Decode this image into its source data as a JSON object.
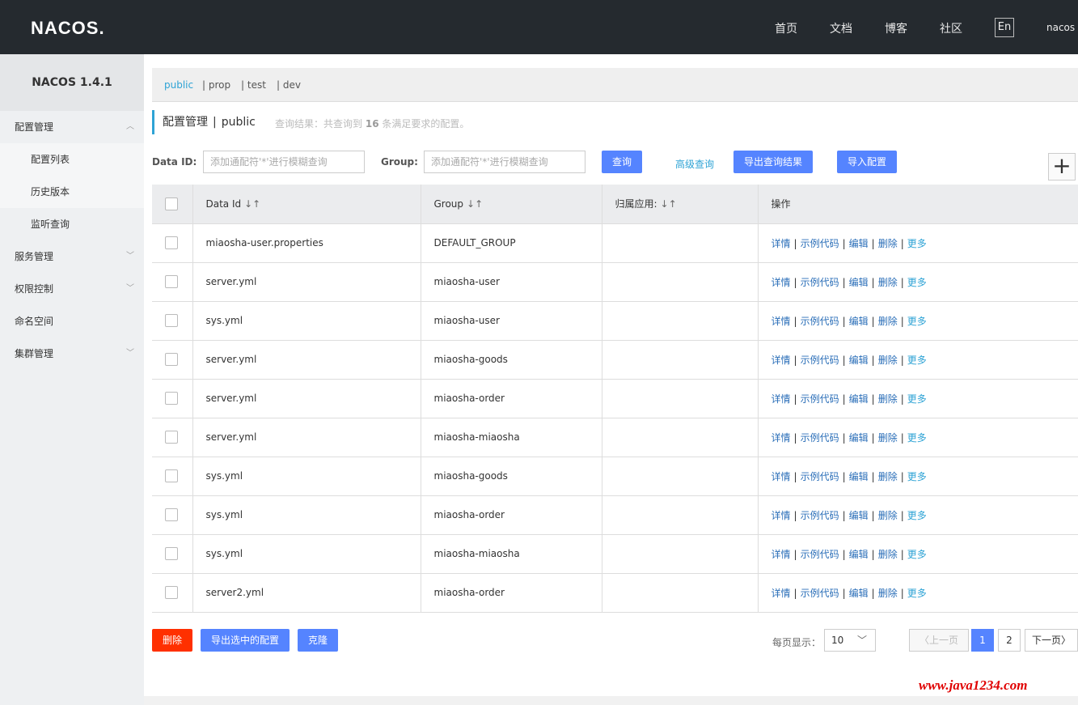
{
  "header": {
    "logo": "NACOS.",
    "nav": [
      "首页",
      "文档",
      "博客",
      "社区"
    ],
    "lang": "En",
    "user": "nacos"
  },
  "sidebar": {
    "version": "NACOS 1.4.1",
    "config_mgmt": "配置管理",
    "config_list": "配置列表",
    "history": "历史版本",
    "listen_query": "监听查询",
    "service_mgmt": "服务管理",
    "permission": "权限控制",
    "namespace": "命名空间",
    "cluster": "集群管理"
  },
  "namespaces": [
    "public",
    "| prop",
    "| test",
    "| dev"
  ],
  "title": {
    "main": "配置管理",
    "sep": "|",
    "ns": "public",
    "result_prefix": "查询结果：共查询到",
    "result_count": "16",
    "result_suffix": "条满足要求的配置。"
  },
  "search": {
    "dataid_label": "Data ID:",
    "dataid_placeholder": "添加通配符'*'进行模糊查询",
    "group_label": "Group:",
    "group_placeholder": "添加通配符'*'进行模糊查询",
    "query_btn": "查询",
    "advanced": "高级查询",
    "export_btn": "导出查询结果",
    "import_btn": "导入配置",
    "plus": "+"
  },
  "table": {
    "headers": [
      "Data Id",
      "Group",
      "归属应用:",
      "操作"
    ],
    "sort_icon": "↓↑",
    "ops": [
      "详情",
      "示例代码",
      "编辑",
      "删除",
      "更多"
    ],
    "rows": [
      {
        "dataid": "miaosha-user.properties",
        "group": "DEFAULT_GROUP",
        "app": ""
      },
      {
        "dataid": "server.yml",
        "group": "miaosha-user",
        "app": ""
      },
      {
        "dataid": "sys.yml",
        "group": "miaosha-user",
        "app": ""
      },
      {
        "dataid": "server.yml",
        "group": "miaosha-goods",
        "app": ""
      },
      {
        "dataid": "server.yml",
        "group": "miaosha-order",
        "app": ""
      },
      {
        "dataid": "server.yml",
        "group": "miaosha-miaosha",
        "app": ""
      },
      {
        "dataid": "sys.yml",
        "group": "miaosha-goods",
        "app": ""
      },
      {
        "dataid": "sys.yml",
        "group": "miaosha-order",
        "app": ""
      },
      {
        "dataid": "sys.yml",
        "group": "miaosha-miaosha",
        "app": ""
      },
      {
        "dataid": "server2.yml",
        "group": "miaosha-order",
        "app": ""
      }
    ]
  },
  "footer": {
    "delete_btn": "删除",
    "export_selected_btn": "导出选中的配置",
    "clone_btn": "克隆",
    "page_size_label": "每页显示：",
    "page_size": "10",
    "prev": "上一页",
    "pages": [
      "1",
      "2"
    ],
    "next": "下一页"
  },
  "watermark": "www.java1234.com",
  "colors": {
    "header_bg": "#252a2f",
    "accent": "#2ea3d5",
    "primary": "#5584ff",
    "danger": "#ff3000"
  }
}
